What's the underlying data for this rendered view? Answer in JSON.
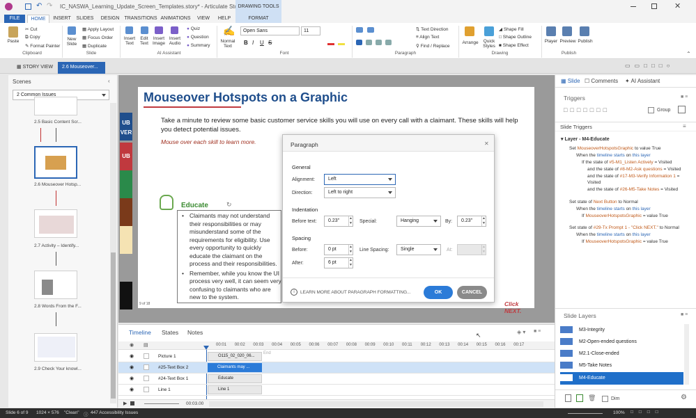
{
  "app": {
    "title": "IC_NASWA_Learning_Update_Screen_Templates.story* - Articulate Storyline x64",
    "contextual_tab_group": "DRAWING TOOLS"
  },
  "menu": {
    "tabs": [
      "FILE",
      "HOME",
      "INSERT",
      "SLIDES",
      "DESIGN",
      "TRANSITIONS",
      "ANIMATIONS",
      "VIEW",
      "HELP",
      "FORMAT"
    ]
  },
  "ribbon": {
    "clipboard": {
      "paste": "Paste",
      "cut": "Cut",
      "copy": "Copy",
      "format_painter": "Format Painter",
      "group": "Clipboard"
    },
    "slide": {
      "new_slide": "New Slide",
      "apply_layout": "Apply Layout",
      "focus_order": "Focus Order",
      "duplicate": "Duplicate",
      "group": "Slide"
    },
    "ai": {
      "insert_text": "Insert Text",
      "edit_text": "Edit Text",
      "insert_image": "Insert Image",
      "insert_audio": "Insert Audio",
      "quiz": "Quiz",
      "question": "Question",
      "summary": "Summary",
      "group": "AI Assistant"
    },
    "font": {
      "normal_text": "Normal Text",
      "font_name": "Open Sans",
      "font_size": "11",
      "group": "Font"
    },
    "paragraph": {
      "text_direction": "Text Direction",
      "align_text": "Align Text",
      "find_replace": "Find / Replace",
      "group": "Paragraph"
    },
    "drawing": {
      "arrange": "Arrange",
      "quick_styles": "Quick Styles",
      "shape_fill": "Shape Fill",
      "shape_outline": "Shape Outline",
      "shape_effect": "Shape Effect",
      "group": "Drawing"
    },
    "publish": {
      "player": "Player",
      "preview": "Preview",
      "publish": "Publish",
      "group": "Publish"
    }
  },
  "doc_tabs": {
    "story_view": "STORY VIEW",
    "active": "2.6 Mouseover..."
  },
  "scenes": {
    "header": "Scenes",
    "dropdown": "2 Common Issues",
    "thumbnails": [
      {
        "label": "2.5 Basic Content Scr..."
      },
      {
        "label": "2.6 Mouseover Hotsp..."
      },
      {
        "label": "2.7 Activity – Identify..."
      },
      {
        "label": "2.8 Words From the F..."
      },
      {
        "label": "2.9 Check Your knowl..."
      }
    ]
  },
  "slide": {
    "title": "Mouseover Hotspots on a Graphic",
    "intro": "Take a minute to review some basic customer service skills you will use on every call with a claimant. These skills will help you detect potential issues.",
    "instruction": "Mouse over each skill to learn more.",
    "side_tabs": [
      "UB",
      "VER",
      "UB"
    ],
    "educate_heading": "Educate",
    "bullets": [
      "Claimants may not understand their responsibilities or may misunderstand some of the requirements for eligibility. Use every opportunity to quickly educate the claimant on the process and their responsibilities.",
      "Remember, while you know the UI process very well, it can seem very confusing to claimants who are new to the system."
    ],
    "page_num": "9 of 18",
    "click_next": "Click NEXT."
  },
  "dialog": {
    "title": "Paragraph",
    "general": "General",
    "alignment_label": "Alignment:",
    "alignment_value": "Left",
    "direction_label": "Direction:",
    "direction_value": "Left to right",
    "indentation": "Indentation",
    "before_text_label": "Before text:",
    "before_text_value": "0.23\"",
    "special_label": "Special:",
    "special_value": "Hanging",
    "by_label": "By:",
    "by_value": "0.23\"",
    "spacing": "Spacing",
    "before_label": "Before:",
    "before_value": "0 pt",
    "line_spacing_label": "Line Spacing:",
    "line_spacing_value": "Single",
    "at_label": "At:",
    "after_label": "After:",
    "after_value": "6 pt",
    "learn_more": "LEARN MORE ABOUT PARAGRAPH FORMATTING...",
    "ok": "OK",
    "cancel": "CANCEL"
  },
  "right_panel": {
    "tabs": [
      "Slide",
      "Comments",
      "AI Assistant"
    ],
    "triggers_header": "Triggers",
    "group_label": "Group",
    "slide_triggers": "Slide Triggers",
    "layer_name": "Layer - M4-Educate",
    "trigger1": {
      "set": "Set",
      "var": "MouseoverHotspotsGraphic",
      "to": "to value",
      "val": "True",
      "when": "When the",
      "event": "timeline starts",
      "on": "on",
      "target": "this layer",
      "if": "If the state of",
      "c1": "#5-M1_Listen Actively",
      "eq": "= Visited",
      "and": "and the state of",
      "c2": "#8-M2-Ask questions",
      "c3": "#17-M3-Verify Information 1",
      "visited": "Visited",
      "c4": "#26-M5-Take Notes"
    },
    "trigger2": {
      "set": "Set state of",
      "obj": "Next Button",
      "to": "to",
      "state": "Normal",
      "when": "When the",
      "event": "timeline starts",
      "on": "on",
      "target": "this layer",
      "if": "If",
      "var": "MouseoverHotspotsGraphic",
      "eq": "= value",
      "val": "True"
    },
    "trigger3": {
      "set": "Set state of",
      "obj": "#29-Tx Prompt 1 - \"Click NEXT.\"",
      "to": "to",
      "state": "Normal",
      "when": "When the",
      "event": "timeline starts",
      "on": "on",
      "target": "this layer",
      "if": "If",
      "var": "MouseoverHotspotsGraphic",
      "eq": "= value",
      "val": "True"
    },
    "slide_layers_header": "Slide Layers",
    "layers": [
      "M3-Integrity",
      "M2-Open-ended questions",
      "M2.1-Close-ended",
      "M5-Take Notes",
      "M4-Educate"
    ],
    "dim_label": "Dim"
  },
  "timeline": {
    "tabs": [
      "Timeline",
      "States",
      "Notes"
    ],
    "ticks": [
      "00:01",
      "00:02",
      "00:03",
      "00:04",
      "00:05",
      "00:06",
      "00:07",
      "00:08",
      "00:09",
      "00:10",
      "00:11",
      "00:12",
      "00:13",
      "00:14",
      "00:15",
      "00:16",
      "00:17"
    ],
    "end_label": "End",
    "rows": [
      {
        "name": "Picture 1",
        "bar": "O115_02_020_06..."
      },
      {
        "name": "#25-Text Box 2",
        "bar": "Claimants may ..."
      },
      {
        "name": "#24-Text Box 1",
        "bar": "Educate"
      },
      {
        "name": "Line 1",
        "bar": "Line 1"
      }
    ],
    "time": "00:03.00"
  },
  "status": {
    "slide": "Slide 6 of 9",
    "size": "1024 × 576",
    "theme": "\"Clean\"",
    "accessibility": "447 Accessibility Issues",
    "zoom": "100%"
  }
}
